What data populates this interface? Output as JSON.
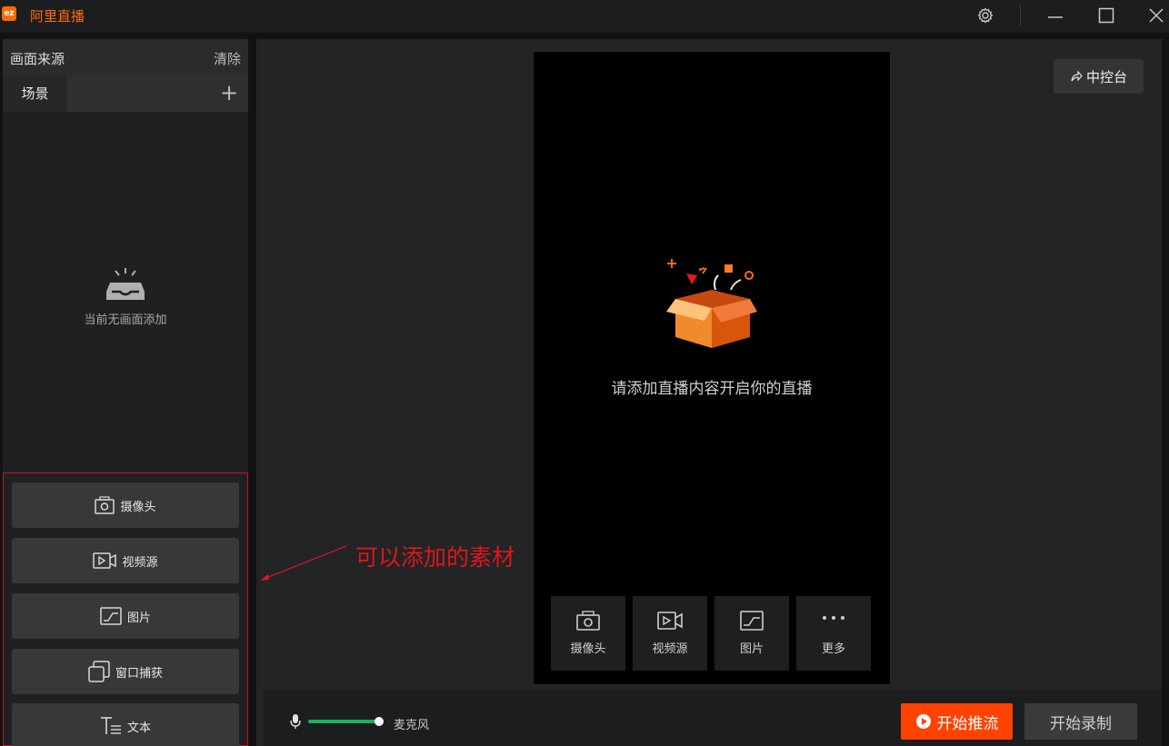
{
  "app": {
    "logo_text": "ez",
    "title": "阿里直播"
  },
  "window": {
    "settings_icon": "gear-icon",
    "minimize_icon": "minimize-icon",
    "maximize_icon": "maximize-icon",
    "close_icon": "close-icon"
  },
  "left_panel": {
    "title": "画面来源",
    "clear_label": "清除",
    "scene_tab": "场景",
    "add_scene_label": "+",
    "empty_text": "当前无画面添加",
    "sources": [
      {
        "label": "摄像头",
        "icon": "camera-icon"
      },
      {
        "label": "视频源",
        "icon": "video-icon"
      },
      {
        "label": "图片",
        "icon": "image-icon"
      },
      {
        "label": "窗口捕获",
        "icon": "window-icon"
      },
      {
        "label": "文本",
        "icon": "text-icon"
      }
    ]
  },
  "annotation": {
    "text": "可以添加的素材",
    "color": "#e0161b"
  },
  "main": {
    "console_label": "中控台",
    "preview_hint": "请添加直播内容开启你的直播",
    "quick_add": [
      {
        "label": "摄像头",
        "icon": "camera-icon"
      },
      {
        "label": "视频源",
        "icon": "video-icon"
      },
      {
        "label": "图片",
        "icon": "image-icon"
      },
      {
        "label": "更多",
        "icon": "more-icon"
      }
    ]
  },
  "bottom_bar": {
    "mic_label": "麦克风",
    "mic_level": 1.0,
    "push_label": "开始推流",
    "record_label": "开始录制"
  },
  "colors": {
    "accent": "#ff6a00",
    "push": "#ff4200",
    "mic_level": "#16b35a"
  }
}
